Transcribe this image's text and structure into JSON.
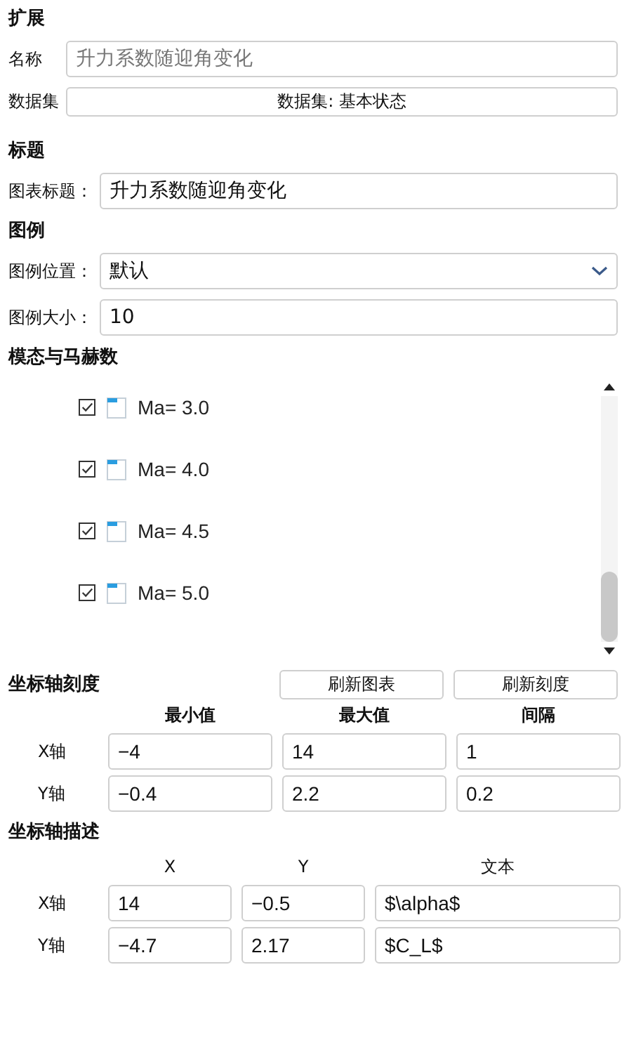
{
  "extension": {
    "heading": "扩展",
    "name": {
      "label": "名称",
      "placeholder": "升力系数随迎角变化"
    },
    "dataset": {
      "label": "数据集",
      "button": "数据集: 基本状态"
    }
  },
  "title": {
    "heading": "标题",
    "chart_title": {
      "label": "图表标题：",
      "value": "升力系数随迎角变化"
    }
  },
  "legend": {
    "heading": "图例",
    "position": {
      "label": "图例位置：",
      "value": "默认"
    },
    "size": {
      "label": "图例大小：",
      "value": "10"
    }
  },
  "modes": {
    "heading": "模态与马赫数",
    "items": [
      {
        "label": "Ma= 3.0",
        "checked": true
      },
      {
        "label": "Ma= 4.0",
        "checked": true
      },
      {
        "label": "Ma= 4.5",
        "checked": true
      },
      {
        "label": "Ma= 5.0",
        "checked": true
      }
    ]
  },
  "axis_ticks": {
    "heading": "坐标轴刻度",
    "buttons": [
      "刷新图表",
      "刷新刻度"
    ],
    "columns": [
      "最小值",
      "最大值",
      "间隔"
    ],
    "rows": [
      {
        "label": "X轴",
        "values": [
          "−4",
          "14",
          "1"
        ]
      },
      {
        "label": "Y轴",
        "values": [
          "−0.4",
          "2.2",
          "0.2"
        ]
      }
    ]
  },
  "axis_labels": {
    "heading": "坐标轴描述",
    "columns": [
      "X",
      "Y",
      "文本"
    ],
    "rows": [
      {
        "label": "X轴",
        "values": [
          "14",
          "−0.5",
          "$\\alpha$"
        ]
      },
      {
        "label": "Y轴",
        "values": [
          "−4.7",
          "2.17",
          "$C_L$"
        ]
      }
    ]
  }
}
